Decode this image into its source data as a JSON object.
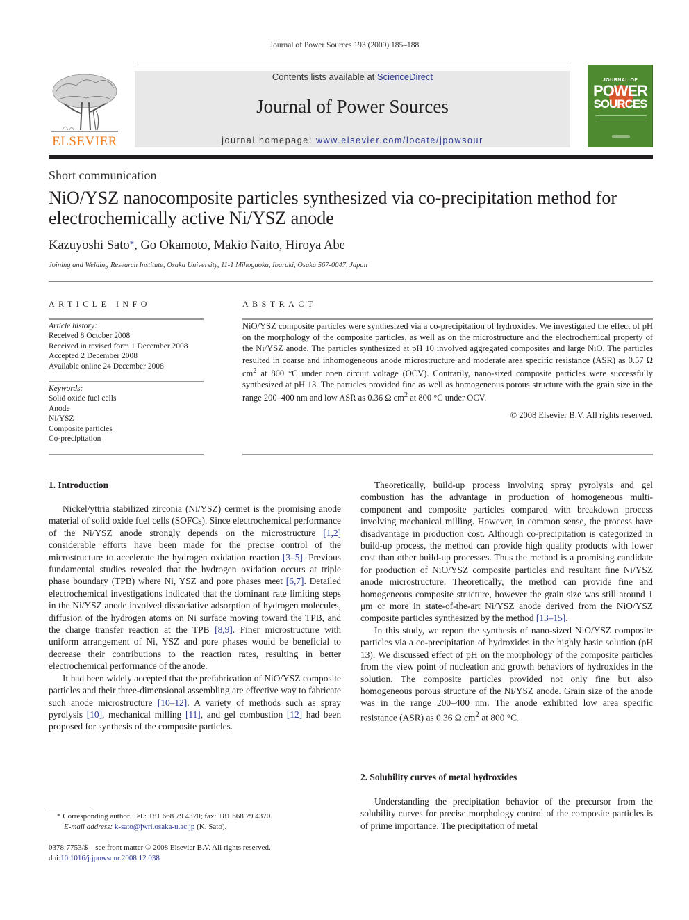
{
  "running_head": "Journal of Power Sources 193 (2009) 185–188",
  "masthead": {
    "publisher_logo_text": "ELSEVIER",
    "contents_prefix": "Contents lists available at ",
    "contents_link": "ScienceDirect",
    "journal_title": "Journal of Power Sources",
    "homepage_prefix": "journal homepage: ",
    "homepage_link": "www.elsevier.com/locate/jpowsour",
    "cover": {
      "head": "JOURNAL OF",
      "line1": "POWER",
      "line2": "SOURCES",
      "bg_color": "#4e8a2f",
      "accent_color": "#d9552a"
    },
    "brand_color": "#f07d1e",
    "link_color": "#2c3993"
  },
  "article": {
    "type": "Short communication",
    "title": "NiO/YSZ nanocomposite particles synthesized via co-precipitation method for electrochemically active Ni/YSZ anode",
    "authors": [
      {
        "name": "Kazuyoshi Sato",
        "corresponding": true
      },
      {
        "name": "Go Okamoto",
        "corresponding": false
      },
      {
        "name": "Makio Naito",
        "corresponding": false
      },
      {
        "name": "Hiroya Abe",
        "corresponding": false
      }
    ],
    "corresponding_mark": "*",
    "separator": ", ",
    "affiliation": "Joining and Welding Research Institute, Osaka University, 11-1 Mihogaoka, Ibaraki, Osaka 567-0047, Japan"
  },
  "article_info": {
    "heading": "ARTICLE INFO",
    "history_label": "Article history:",
    "history": [
      "Received 8 October 2008",
      "Received in revised form 1 December 2008",
      "Accepted 2 December 2008",
      "Available online 24 December 2008"
    ],
    "keywords_label": "Keywords:",
    "keywords": [
      "Solid oxide fuel cells",
      "Anode",
      "Ni/YSZ",
      "Composite particles",
      "Co-precipitation"
    ]
  },
  "abstract": {
    "heading": "ABSTRACT",
    "text_1": "NiO/YSZ composite particles were synthesized via a co-precipitation of hydroxides. We investigated the effect of pH on the morphology of the composite particles, as well as on the microstructure and the electrochemical property of the Ni/YSZ anode. The particles synthesized at pH 10 involved aggregated composites and large NiO. The particles resulted in coarse and inhomogeneous anode microstructure and moderate area specific resistance (ASR) as 0.57 Ω cm",
    "text_2": " at 800 °C under open circuit voltage (OCV). Contrarily, nano-sized composite particles were successfully synthesized at pH 13. The particles provided fine as well as homogeneous porous structure with the grain size in the range 200–400 nm and low ASR as 0.36 Ω cm",
    "text_3": " at 800 °C under OCV.",
    "sup": "2",
    "copyright": "© 2008 Elsevier B.V. All rights reserved."
  },
  "sections": {
    "intro_heading": "1.  Introduction",
    "intro_p1": {
      "a": "Nickel/yttria stabilized zirconia (Ni/YSZ) cermet is the promising anode material of solid oxide fuel cells (SOFCs). Since electrochemical performance of the Ni/YSZ anode strongly depends on the microstructure ",
      "ref1": "[1,2]",
      "b": " considerable efforts have been made for the precise control of the microstructure to accelerate the hydrogen oxidation reaction ",
      "ref2": "[3–5]",
      "c": ". Previous fundamental studies revealed that the hydrogen oxidation occurs at triple phase boundary (TPB) where Ni, YSZ and pore phases meet ",
      "ref3": "[6,7]",
      "d": ". Detailed electrochemical investigations indicated that the dominant rate limiting steps in the Ni/YSZ anode involved dissociative adsorption of hydrogen molecules, diffusion of the hydrogen atoms on Ni surface moving toward the TPB, and the charge transfer reaction at the TPB ",
      "ref4": "[8,9]",
      "e": ". Finer microstructure with uniform arrangement of Ni, YSZ and pore phases would be beneficial to decrease their contributions to the reaction rates, resulting in better electrochemical performance of the anode."
    },
    "intro_p2": {
      "a": "It had been widely accepted that the prefabrication of NiO/YSZ composite particles and their three-dimensional assembling are effective way to fabricate such anode microstructure ",
      "ref1": "[10–12]",
      "b": ". A variety of methods such as spray pyrolysis ",
      "ref2": "[10]",
      "c": ", mechanical milling ",
      "ref3": "[11]",
      "d": ", and gel combustion ",
      "ref4": "[12]",
      "e": " had been proposed for synthesis of the composite particles."
    },
    "intro_p3": {
      "a": "Theoretically, build-up process involving spray pyrolysis and gel combustion has the advantage in production of homogeneous multi-component and composite particles compared with breakdown process involving mechanical milling. However, in common sense, the process have disadvantage in production cost. Although co-precipitation is categorized in build-up process, the method can provide high quality products with lower cost than other build-up processes. Thus the method is a promising candidate for production of NiO/YSZ composite particles and resultant fine Ni/YSZ anode microstructure. Theoretically, the method can provide fine and homogeneous composite structure, however the grain size was still around 1 μm or more in state-of-the-art Ni/YSZ anode derived from the NiO/YSZ composite particles synthesized by the method ",
      "ref1": "[13–15]",
      "b": "."
    },
    "intro_p4": {
      "a": "In this study, we report the synthesis of nano-sized NiO/YSZ composite particles via a co-precipitation of hydroxides in the highly basic solution (pH 13). We discussed effect of pH on the morphology of the composite particles from the view point of nucleation and growth behaviors of hydroxides in the solution. The composite particles provided not only fine but also homogeneous porous structure of the Ni/YSZ anode. Grain size of the anode was in the range 200–400 nm. The anode exhibited low area specific resistance (ASR) as 0.36 Ω cm",
      "sup": "2",
      "b": " at 800 °C."
    },
    "sec2_heading": "2.  Solubility curves of metal hydroxides",
    "sec2_p1": "Understanding the precipitation behavior of the precursor from the solubility curves for precise morphology control of the composite particles is of prime importance. The precipitation of metal"
  },
  "footnote": {
    "mark": "*",
    "contact": "  Corresponding author. Tel.: +81 668 79 4370; fax: +81 668 79 4370.",
    "email_label": "E-mail address: ",
    "email": "k-sato@jwri.osaka-u.ac.jp",
    "email_suffix": " (K. Sato)."
  },
  "front_matter": {
    "issn_line": "0378-7753/$ – see front matter © 2008 Elsevier B.V. All rights reserved.",
    "doi_prefix": "doi:",
    "doi": "10.1016/j.jpowsour.2008.12.038"
  }
}
